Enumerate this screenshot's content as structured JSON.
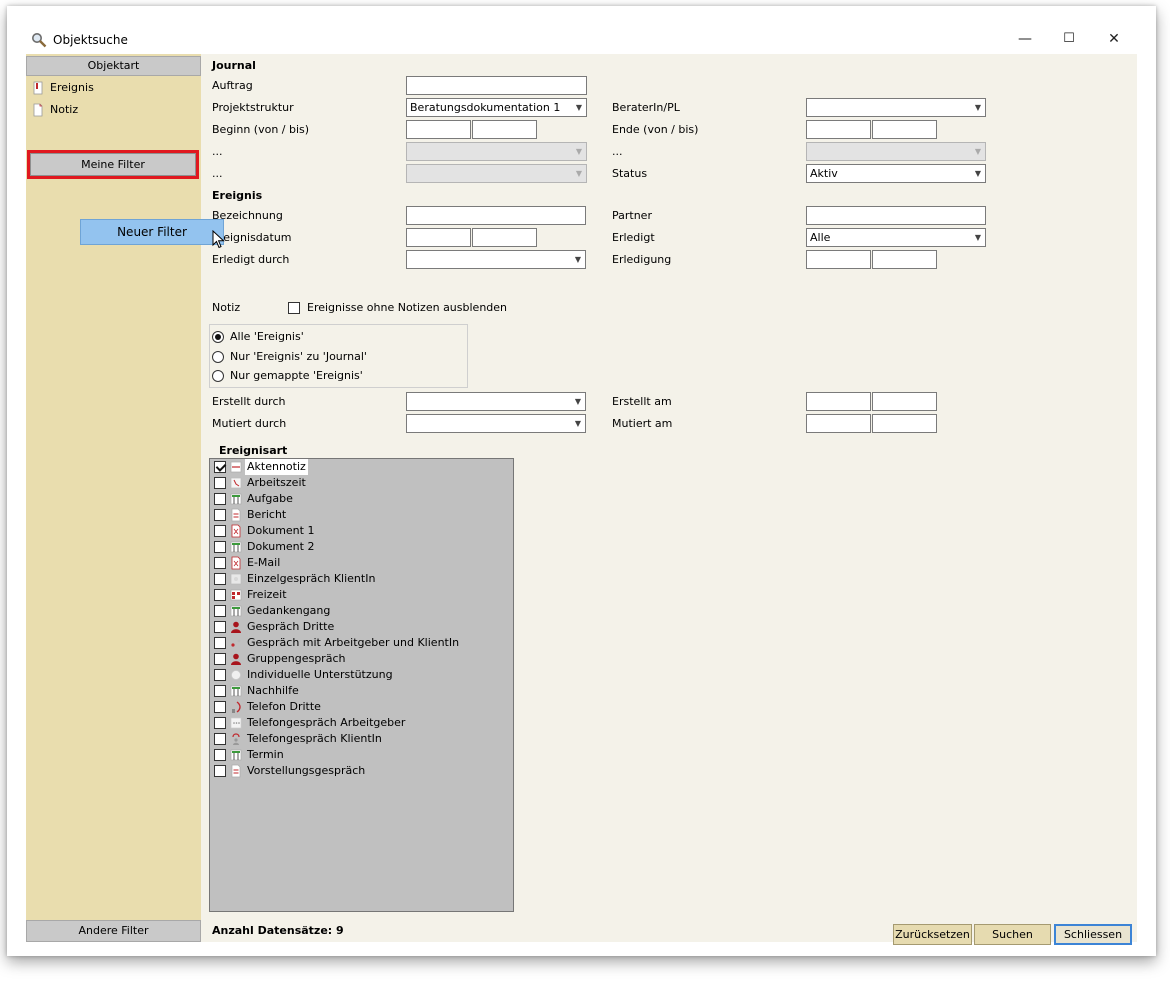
{
  "window": {
    "title": "Objektsuche",
    "minimize": "—",
    "maximize": "☐",
    "close": "✕"
  },
  "left": {
    "header": "Objektart",
    "items": [
      {
        "label": "Ereignis",
        "icon": "event-icon"
      },
      {
        "label": "Notiz",
        "icon": "note-icon"
      }
    ],
    "my_filters": "Meine Filter",
    "context_menu": "Neuer Filter",
    "other_filters": "Andere Filter"
  },
  "journal": {
    "section": "Journal",
    "auftrag_label": "Auftrag",
    "auftrag_value": "",
    "projektstruktur_label": "Projektstruktur",
    "projektstruktur_value": "Beratungsdokumentation 1",
    "berater_label": "BeraterIn/PL",
    "berater_value": "",
    "beginn_label": "Beginn (von / bis)",
    "ende_label": "Ende (von / bis)",
    "dots1_label": "...",
    "dots2_label": "...",
    "dots3_label": "...",
    "dots4_label": "...",
    "status_label": "Status",
    "status_value": "Aktiv"
  },
  "ereignis": {
    "section": "Ereignis",
    "bezeichnung_label": "Bezeichnung",
    "partner_label": "Partner",
    "datum_label": "Ereignisdatum",
    "erledigt_label": "Erledigt",
    "erledigt_value": "Alle",
    "erledigt_durch_label": "Erledigt durch",
    "erledigung_label": "Erledigung"
  },
  "notiz": {
    "label": "Notiz",
    "checkbox_label": "Ereignisse ohne Notizen ausblenden",
    "radios": [
      "Alle 'Ereignis'",
      "Nur 'Ereignis' zu 'Journal'",
      "Nur gemappte 'Ereignis'"
    ]
  },
  "meta": {
    "erstellt_durch_label": "Erstellt durch",
    "erstellt_am_label": "Erstellt am",
    "mutiert_durch_label": "Mutiert durch",
    "mutiert_am_label": "Mutiert am"
  },
  "ereignisart": {
    "section": "Ereignisart",
    "items": [
      {
        "label": "Aktennotiz",
        "checked": true
      },
      {
        "label": "Arbeitszeit",
        "checked": false
      },
      {
        "label": "Aufgabe",
        "checked": false
      },
      {
        "label": "Bericht",
        "checked": false
      },
      {
        "label": "Dokument 1",
        "checked": false
      },
      {
        "label": "Dokument 2",
        "checked": false
      },
      {
        "label": "E-Mail",
        "checked": false
      },
      {
        "label": "Einzelgespräch KlientIn",
        "checked": false
      },
      {
        "label": "Freizeit",
        "checked": false
      },
      {
        "label": "Gedankengang",
        "checked": false
      },
      {
        "label": "Gespräch Dritte",
        "checked": false
      },
      {
        "label": "Gespräch mit Arbeitgeber und KlientIn",
        "checked": false
      },
      {
        "label": "Gruppengespräch",
        "checked": false
      },
      {
        "label": "Individuelle Unterstützung",
        "checked": false
      },
      {
        "label": "Nachhilfe",
        "checked": false
      },
      {
        "label": "Telefon Dritte",
        "checked": false
      },
      {
        "label": "Telefongespräch Arbeitgeber",
        "checked": false
      },
      {
        "label": "Telefongespräch KlientIn",
        "checked": false
      },
      {
        "label": "Termin",
        "checked": false
      },
      {
        "label": "Vorstellungsgespräch",
        "checked": false
      }
    ]
  },
  "footer": {
    "count_label": "Anzahl Datensätze: 9",
    "reset": "Zurücksetzen",
    "search": "Suchen",
    "close": "Schliessen"
  },
  "colors": {
    "left_pane": "#e9ddae",
    "highlight_outline": "#e0181f",
    "context_menu": "#93c3ef",
    "default_button_border": "#3c84d6"
  }
}
